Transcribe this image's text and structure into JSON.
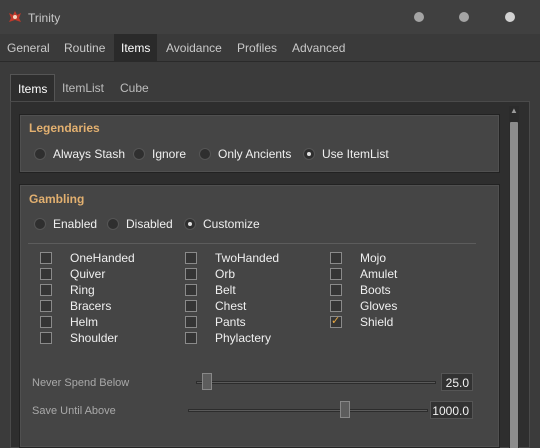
{
  "window": {
    "title": "Trinity"
  },
  "main_tabs": [
    {
      "label": "General"
    },
    {
      "label": "Routine"
    },
    {
      "label": "Items"
    },
    {
      "label": "Avoidance"
    },
    {
      "label": "Profiles"
    },
    {
      "label": "Advanced"
    }
  ],
  "sub_tabs": [
    {
      "label": "Items"
    },
    {
      "label": "ItemList"
    },
    {
      "label": "Cube"
    }
  ],
  "legendaries": {
    "title": "Legendaries",
    "options": [
      {
        "label": "Always Stash"
      },
      {
        "label": "Ignore"
      },
      {
        "label": "Only Ancients"
      },
      {
        "label": "Use ItemList"
      }
    ],
    "selected": "Use ItemList"
  },
  "gambling": {
    "title": "Gambling",
    "options": [
      {
        "label": "Enabled"
      },
      {
        "label": "Disabled"
      },
      {
        "label": "Customize"
      }
    ],
    "selected": "Customize",
    "items": [
      {
        "label": "OneHanded",
        "checked": false
      },
      {
        "label": "Quiver",
        "checked": false
      },
      {
        "label": "Ring",
        "checked": false
      },
      {
        "label": "Bracers",
        "checked": false
      },
      {
        "label": "Helm",
        "checked": false
      },
      {
        "label": "Shoulder",
        "checked": false
      },
      {
        "label": "TwoHanded",
        "checked": false
      },
      {
        "label": "Orb",
        "checked": false
      },
      {
        "label": "Belt",
        "checked": false
      },
      {
        "label": "Chest",
        "checked": false
      },
      {
        "label": "Pants",
        "checked": false
      },
      {
        "label": "Phylactery",
        "checked": false
      },
      {
        "label": "Mojo",
        "checked": false
      },
      {
        "label": "Amulet",
        "checked": false
      },
      {
        "label": "Boots",
        "checked": false
      },
      {
        "label": "Gloves",
        "checked": false
      },
      {
        "label": "Shield",
        "checked": true
      }
    ],
    "never_spend_below": {
      "label": "Never Spend Below",
      "value": "25.0"
    },
    "save_until_above": {
      "label": "Save Until Above",
      "value": "1000.0"
    }
  },
  "colors": {
    "accent": "#e2b070",
    "check": "#e8a840"
  }
}
